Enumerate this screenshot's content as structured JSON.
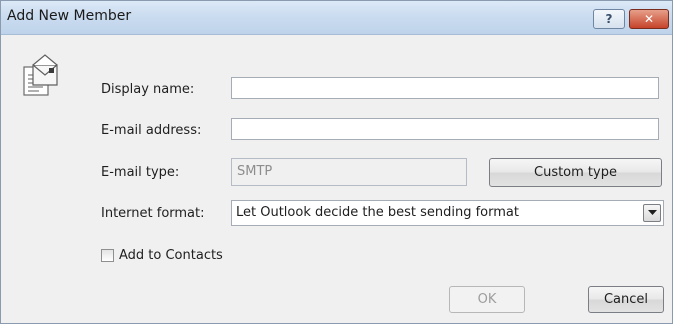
{
  "window": {
    "title": "Add New Member",
    "help_button": "?",
    "close_button": "✕"
  },
  "form": {
    "display_name": {
      "label": "Display name:",
      "value": ""
    },
    "email_address": {
      "label": "E-mail address:",
      "value": ""
    },
    "email_type": {
      "label": "E-mail type:",
      "value": "SMTP"
    },
    "custom_type_button": "Custom type",
    "internet_format": {
      "label": "Internet format:",
      "selected": "Let Outlook decide the best sending format"
    },
    "add_to_contacts": {
      "label": "Add to Contacts",
      "checked": false
    }
  },
  "buttons": {
    "ok": "OK",
    "cancel": "Cancel"
  },
  "icons": {
    "member": "envelope-card-icon",
    "dropdown": "chevron-down-icon"
  }
}
